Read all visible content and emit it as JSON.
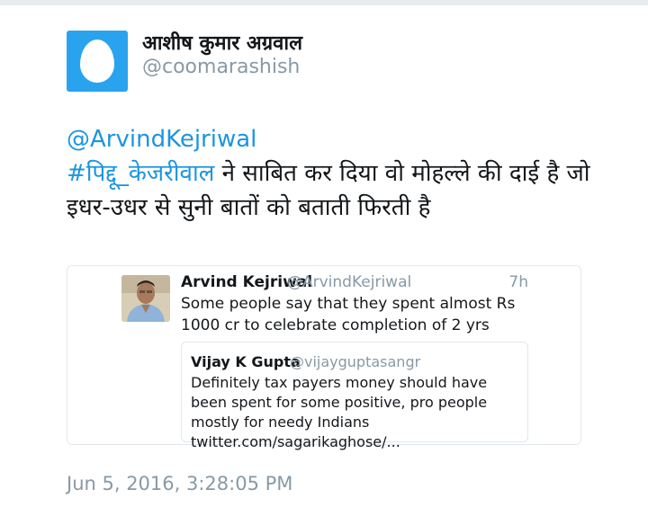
{
  "author": {
    "display_name": "आशीष कुमार अग्रवाल",
    "handle": "@coomarashish",
    "avatar_icon": "default-egg-icon",
    "avatar_color": "#2aa3ef"
  },
  "tweet": {
    "mention": "@ArvindKejriwal",
    "hashtag": "#पिद्दू_केजरीवाल",
    "body": " ने साबित कर दिया वो मोहल्ले की दाई है जो इधर-उधर से सुनी बातों को बताती फिरती है",
    "link_color": "#1b95e0"
  },
  "quoted_tweet": {
    "name": "Arvind Kejriwal",
    "handle": "@ArvindKejriwal",
    "time": "7h",
    "text": "Some people say that they spent almost Rs 1000 cr to celebrate completion of 2 yrs",
    "avatar_icon": "profile-photo-icon",
    "nested_quote": {
      "name": "Vijay K Gupta",
      "handle": "@vijayguptasangr",
      "text": "Definitely tax payers money should have been spent for some positive, pro people mostly for needy Indians twitter.com/sagarikaghose/..."
    }
  },
  "timestamp": "Jun 5, 2016, 3:28:05 PM"
}
